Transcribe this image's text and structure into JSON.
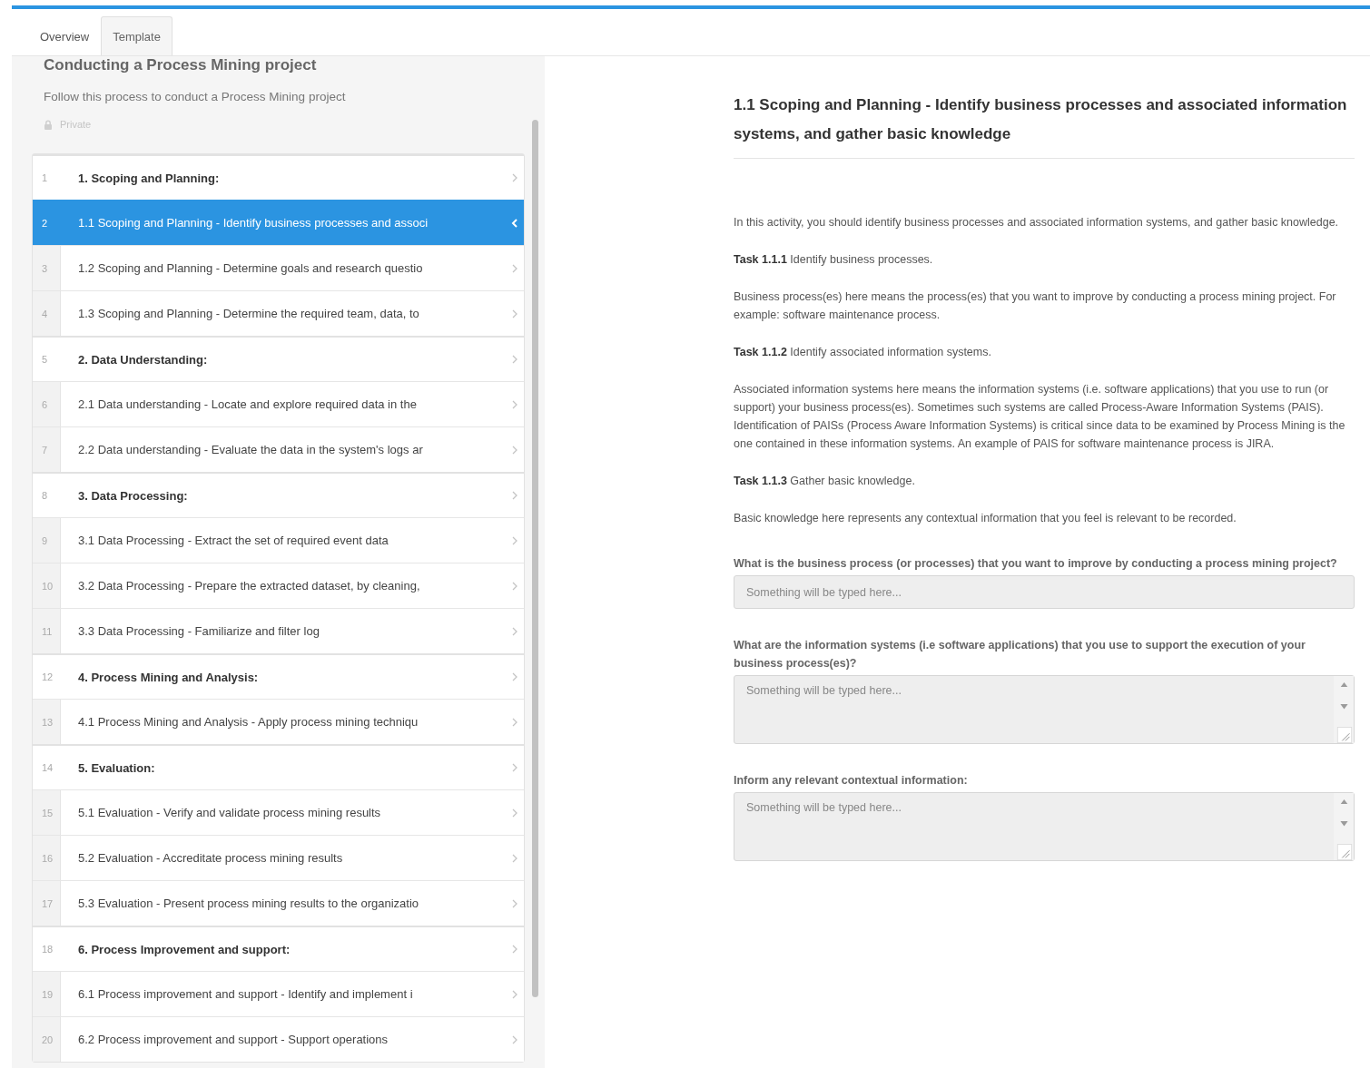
{
  "tabs": [
    {
      "label": "Overview",
      "selected": false
    },
    {
      "label": "Template",
      "selected": true
    }
  ],
  "template": {
    "title": "Conducting a Process Mining project",
    "description": "Follow this process to conduct a Process Mining project",
    "visibility": "Private"
  },
  "steps": [
    {
      "number": "1",
      "label": "1. Scoping and Planning:",
      "kind": "section",
      "selected": false
    },
    {
      "number": "2",
      "label": "1.1 Scoping and Planning - Identify business processes and associ",
      "kind": "task",
      "selected": true
    },
    {
      "number": "3",
      "label": "1.2 Scoping and Planning - Determine goals and research questio",
      "kind": "task",
      "selected": false
    },
    {
      "number": "4",
      "label": "1.3 Scoping and Planning - Determine the required team, data, to",
      "kind": "task",
      "selected": false
    },
    {
      "number": "5",
      "label": "2. Data Understanding:",
      "kind": "section",
      "selected": false
    },
    {
      "number": "6",
      "label": "2.1 Data understanding - Locate and explore required data in the",
      "kind": "task",
      "selected": false
    },
    {
      "number": "7",
      "label": "2.2 Data understanding - Evaluate the data in the system's logs ar",
      "kind": "task",
      "selected": false
    },
    {
      "number": "8",
      "label": "3. Data Processing:",
      "kind": "section",
      "selected": false
    },
    {
      "number": "9",
      "label": "3.1 Data Processing - Extract the set of required event data",
      "kind": "task",
      "selected": false
    },
    {
      "number": "10",
      "label": "3.2 Data Processing - Prepare the extracted dataset, by cleaning,",
      "kind": "task",
      "selected": false
    },
    {
      "number": "11",
      "label": "3.3 Data Processing - Familiarize and filter log",
      "kind": "task",
      "selected": false
    },
    {
      "number": "12",
      "label": "4. Process Mining and Analysis:",
      "kind": "section",
      "selected": false
    },
    {
      "number": "13",
      "label": "4.1 Process Mining and Analysis - Apply process mining techniqu",
      "kind": "task",
      "selected": false
    },
    {
      "number": "14",
      "label": "5. Evaluation:",
      "kind": "section",
      "selected": false
    },
    {
      "number": "15",
      "label": "5.1 Evaluation - Verify and validate process mining results",
      "kind": "task",
      "selected": false
    },
    {
      "number": "16",
      "label": "5.2 Evaluation - Accreditate process mining results",
      "kind": "task",
      "selected": false
    },
    {
      "number": "17",
      "label": "5.3 Evaluation - Present process mining results to the organizatio",
      "kind": "task",
      "selected": false
    },
    {
      "number": "18",
      "label": "6. Process Improvement and support:",
      "kind": "section",
      "selected": false
    },
    {
      "number": "19",
      "label": "6.1 Process improvement and support - Identify and implement i",
      "kind": "task",
      "selected": false
    },
    {
      "number": "20",
      "label": "6.2 Process improvement and support - Support operations",
      "kind": "task",
      "selected": false
    }
  ],
  "activity": {
    "title": "1.1 Scoping and Planning - Identify business processes and associated information systems, and gather basic knowledge",
    "paragraphs": [
      "In this activity, you should identify business processes and associated information systems, and gather basic knowledge.",
      "**Task 1.1.1** Identify business processes.",
      "Business process(es) here means the process(es) that you want to improve by conducting a process mining project. For example: software maintenance process.",
      "**Task 1.1.2** Identify associated information systems.",
      "Associated information systems here means the information systems (i.e. software applications) that you use to run (or support) your business process(es). Sometimes such systems are called Process-Aware Information Systems (PAIS). Identification of PAISs (Process Aware Information Systems) is critical since data to be examined by Process Mining is the one contained in these information systems. An example of PAIS for software maintenance process is JIRA.",
      "**Task 1.1.3** Gather basic knowledge.",
      "Basic knowledge here represents any contextual information that you feel is relevant to be recorded."
    ],
    "questions": [
      {
        "label": "What is the business process (or processes) that you want to improve by conducting a process mining project?",
        "kind": "line",
        "placeholder": "Something will be typed here..."
      },
      {
        "label": "What are the information systems (i.e software applications) that you use to support the execution of your business process(es)?",
        "kind": "multiline",
        "placeholder": "Something will be typed here..."
      },
      {
        "label": "Inform any relevant contextual information:",
        "kind": "multiline",
        "placeholder": "Something will be typed here..."
      }
    ]
  }
}
